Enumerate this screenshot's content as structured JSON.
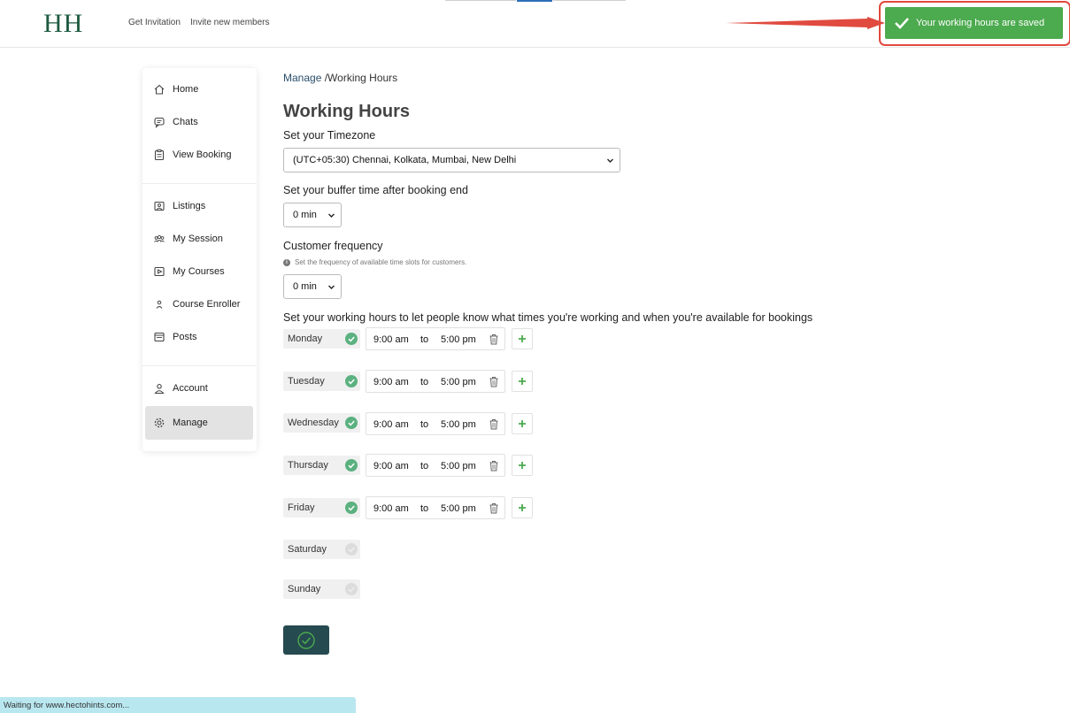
{
  "header": {
    "logo": "HH",
    "nav": [
      "Get Invitation",
      "Invite new members"
    ]
  },
  "toast": {
    "message": "Your working hours are saved",
    "color": "#4caa4f"
  },
  "sidebar": {
    "items": [
      {
        "label": "Home",
        "icon": "home-icon"
      },
      {
        "label": "Chats",
        "icon": "chat-icon"
      },
      {
        "label": "View Booking",
        "icon": "clipboard-icon"
      },
      {
        "label": "Listings",
        "icon": "listing-icon"
      },
      {
        "label": "My Session",
        "icon": "group-icon"
      },
      {
        "label": "My Courses",
        "icon": "play-icon"
      },
      {
        "label": "Course Enroller",
        "icon": "person-icon"
      },
      {
        "label": "Posts",
        "icon": "posts-icon"
      },
      {
        "label": "Account",
        "icon": "account-icon"
      },
      {
        "label": "Manage",
        "icon": "gear-icon",
        "active": true
      }
    ]
  },
  "breadcrumb": {
    "link": "Manage",
    "current": " /Working Hours"
  },
  "page": {
    "title": "Working Hours",
    "timezone_label": "Set your Timezone",
    "timezone_value": "(UTC+05:30) Chennai, Kolkata, Mumbai, New Delhi",
    "buffer_label": "Set your buffer time after booking end",
    "buffer_value": "0 min",
    "frequency_label": "Customer frequency",
    "frequency_help": "Set the frequency of available time slots for customers.",
    "frequency_value": "0 min",
    "hours_label": "Set your working hours to let people know what times you're working and when you're available for bookings"
  },
  "days": [
    {
      "name": "Monday",
      "enabled": true,
      "start": "9:00 am",
      "to": "to",
      "end": "5:00 pm"
    },
    {
      "name": "Tuesday",
      "enabled": true,
      "start": "9:00 am",
      "to": "to",
      "end": "5:00 pm"
    },
    {
      "name": "Wednesday",
      "enabled": true,
      "start": "9:00 am",
      "to": "to",
      "end": "5:00 pm"
    },
    {
      "name": "Thursday",
      "enabled": true,
      "start": "9:00 am",
      "to": "to",
      "end": "5:00 pm"
    },
    {
      "name": "Friday",
      "enabled": true,
      "start": "9:00 am",
      "to": "to",
      "end": "5:00 pm"
    },
    {
      "name": "Saturday",
      "enabled": false
    },
    {
      "name": "Sunday",
      "enabled": false
    }
  ],
  "status_bar": "Waiting for www.hectohints.com..."
}
